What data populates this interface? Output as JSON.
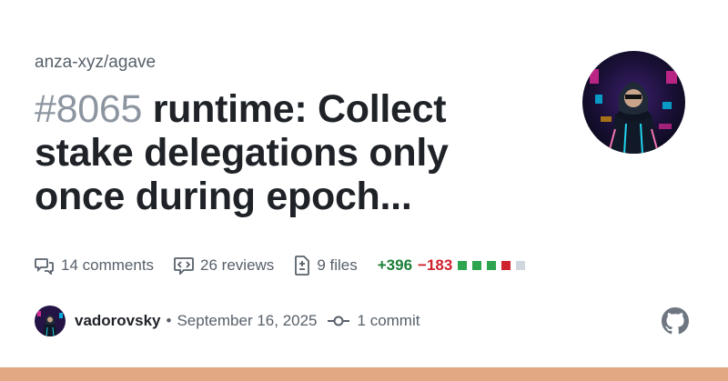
{
  "repo": "anza-xyz/agave",
  "pr": {
    "number": "#8065",
    "title": "runtime: Collect stake delegations only once during epoch..."
  },
  "stats": {
    "comments": "14 comments",
    "reviews": "26 reviews",
    "files": "9 files",
    "additions": "+396",
    "deletions": "−183",
    "diff_squares": [
      "green",
      "green",
      "green",
      "red",
      "gray"
    ]
  },
  "author": {
    "name": "vadorovsky",
    "separator": "•",
    "date": "September 16, 2025",
    "commits": "1 commit"
  },
  "colors": {
    "addition": "#1a7f37",
    "deletion": "#cf222e",
    "footer_bar": "#e0a883",
    "neutral": "#d0d7de"
  },
  "icons": [
    "comment-icon",
    "review-icon",
    "file-diff-icon",
    "commit-icon",
    "github-logo-icon"
  ]
}
